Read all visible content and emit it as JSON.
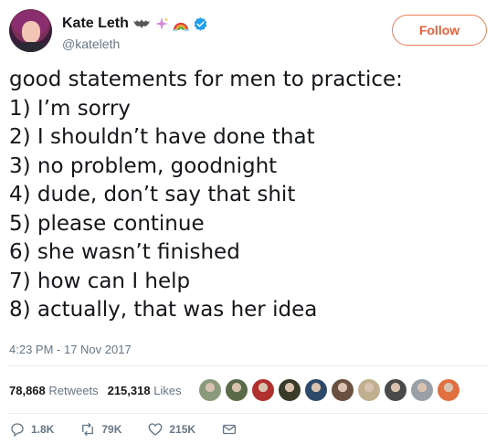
{
  "author": {
    "display_name": "Kate Leth",
    "handle": "@kateleth",
    "name_emojis": [
      "bat-icon",
      "sparkles-icon",
      "rainbow-icon"
    ],
    "verified": true
  },
  "follow_label": "Follow",
  "tweet": {
    "lines": [
      "good statements for men to practice:",
      "1) I’m sorry",
      "2) I shouldn’t have done that",
      "3) no problem, goodnight",
      "4) dude, don’t say that shit",
      "5) please continue",
      "6) she wasn’t finished",
      "7) how can I help",
      "8) actually, that was her idea"
    ],
    "timestamp": "4:23 PM - 17 Nov 2017"
  },
  "stats": {
    "retweets_count": "78,868",
    "retweets_label": "Retweets",
    "likes_count": "215,318",
    "likes_label": "Likes"
  },
  "likers": [
    {
      "color": "#8a9a7a"
    },
    {
      "color": "#5a6b4a"
    },
    {
      "color": "#b03030"
    },
    {
      "color": "#3a3a2a"
    },
    {
      "color": "#2e4a6a"
    },
    {
      "color": "#6a5040"
    },
    {
      "color": "#c0b090"
    },
    {
      "color": "#4a4a4a"
    },
    {
      "color": "#9aa0a8"
    },
    {
      "color": "#e07040"
    }
  ],
  "actions": {
    "reply_count": "1.8K",
    "retweet_count": "79K",
    "like_count": "215K"
  },
  "colors": {
    "accent": "#e8613a",
    "verified": "#1da1f2",
    "secondary_text": "#657786"
  }
}
